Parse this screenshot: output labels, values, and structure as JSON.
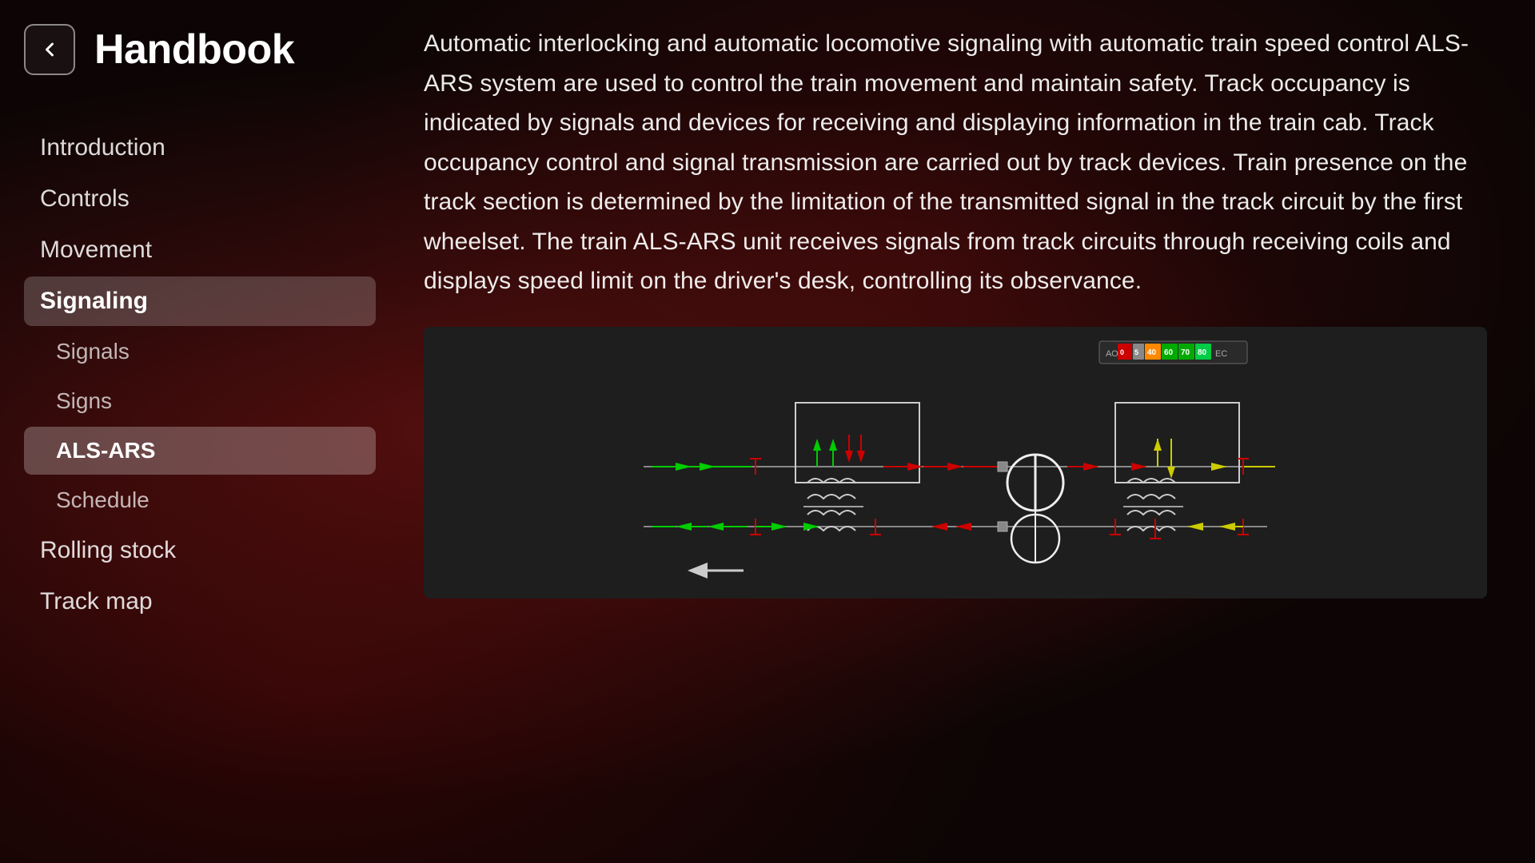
{
  "app": {
    "title": "Handbook",
    "back_label": "back"
  },
  "sidebar": {
    "nav_items": [
      {
        "id": "introduction",
        "label": "Introduction",
        "active": false,
        "sub": false
      },
      {
        "id": "controls",
        "label": "Controls",
        "active": false,
        "sub": false
      },
      {
        "id": "movement",
        "label": "Movement",
        "active": false,
        "sub": false
      },
      {
        "id": "signaling",
        "label": "Signaling",
        "active": true,
        "sub": false
      },
      {
        "id": "signals",
        "label": "Signals",
        "active": false,
        "sub": true
      },
      {
        "id": "signs",
        "label": "Signs",
        "active": false,
        "sub": true
      },
      {
        "id": "als-ars",
        "label": "ALS-ARS",
        "active": true,
        "sub": true
      },
      {
        "id": "schedule",
        "label": "Schedule",
        "active": false,
        "sub": true
      },
      {
        "id": "rolling-stock",
        "label": "Rolling stock",
        "active": false,
        "sub": false
      },
      {
        "id": "track-map",
        "label": "Track map",
        "active": false,
        "sub": false
      }
    ]
  },
  "content": {
    "description": "Automatic interlocking and automatic locomotive signaling with automatic train speed control ALS-ARS system are used to control the train movement and maintain safety. Track occupancy is indicated by signals and devices for receiving and displaying information in the train cab. Track occupancy control and signal transmission are carried out by track devices. Train presence on the track section is determined by the limitation of the transmitted signal in the track circuit by the first wheelset. The train ALS-ARS unit receives signals from track circuits through receiving coils and displays speed limit on the driver's desk, controlling its observance."
  },
  "speed_indicator": {
    "label_left": "АО",
    "speeds": [
      "0",
      "5",
      "40",
      "60",
      "70",
      "80"
    ],
    "label_right": "ЕС"
  },
  "icons": {
    "back": "←"
  }
}
